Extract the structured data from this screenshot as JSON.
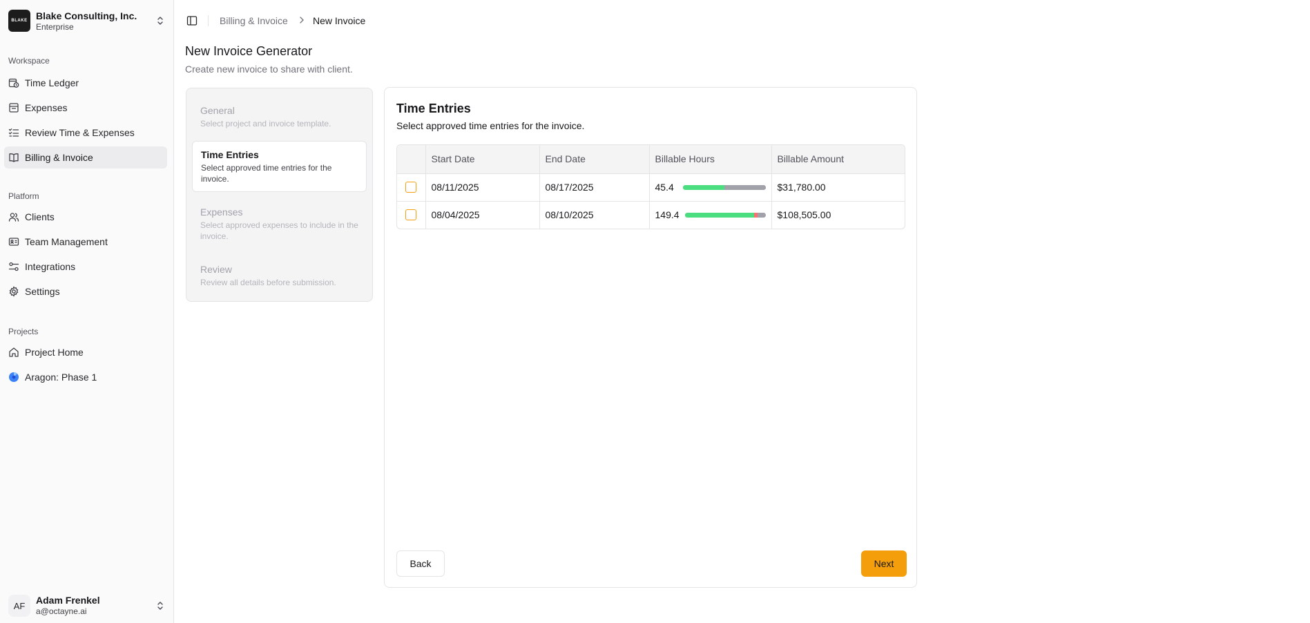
{
  "org": {
    "logo_text": "BLAKE",
    "name": "Blake Consulting, Inc.",
    "plan": "Enterprise"
  },
  "sidebar": {
    "workspace_label": "Workspace",
    "workspace_items": [
      {
        "label": "Time Ledger",
        "icon": "clock-calendar-icon"
      },
      {
        "label": "Expenses",
        "icon": "receipt-icon"
      },
      {
        "label": "Review Time & Expenses",
        "icon": "list-check-icon"
      },
      {
        "label": "Billing & Invoice",
        "icon": "book-icon",
        "active": true
      }
    ],
    "platform_label": "Platform",
    "platform_items": [
      {
        "label": "Clients",
        "icon": "users-icon"
      },
      {
        "label": "Team Management",
        "icon": "id-card-icon"
      },
      {
        "label": "Integrations",
        "icon": "sliders-icon"
      },
      {
        "label": "Settings",
        "icon": "gear-icon"
      }
    ],
    "projects_label": "Projects",
    "project_items": [
      {
        "label": "Project Home",
        "icon": "home-icon"
      },
      {
        "label": "Aragon: Phase 1",
        "icon": "pie-icon"
      }
    ]
  },
  "user": {
    "initials": "AF",
    "name": "Adam Frenkel",
    "email": "a@octayne.ai"
  },
  "breadcrumb": {
    "parent": "Billing & Invoice",
    "current": "New Invoice"
  },
  "page": {
    "title": "New Invoice Generator",
    "subtitle": "Create new invoice to share with client."
  },
  "steps": [
    {
      "title": "General",
      "desc": "Select project and invoice template."
    },
    {
      "title": "Time Entries",
      "desc": "Select approved time entries for the invoice.",
      "active": true
    },
    {
      "title": "Expenses",
      "desc": "Select approved expenses to include in the invoice."
    },
    {
      "title": "Review",
      "desc": "Review all details before submission."
    }
  ],
  "card": {
    "title": "Time Entries",
    "subtitle": "Select approved time entries for the invoice.",
    "columns": [
      "Start Date",
      "End Date",
      "Billable Hours",
      "Billable Amount"
    ],
    "rows": [
      {
        "start": "08/11/2025",
        "end": "08/17/2025",
        "hours": "45.4",
        "amount": "$31,780.00",
        "bar": [
          {
            "kind": "g",
            "frac": 0.5
          },
          {
            "kind": "gy",
            "frac": 0.5
          }
        ]
      },
      {
        "start": "08/04/2025",
        "end": "08/10/2025",
        "hours": "149.4",
        "amount": "$108,505.00",
        "bar": [
          {
            "kind": "g",
            "frac": 0.86
          },
          {
            "kind": "r",
            "frac": 0.04
          },
          {
            "kind": "gy",
            "frac": 0.1
          }
        ]
      }
    ],
    "back_label": "Back",
    "next_label": "Next"
  },
  "colors": {
    "accent": "#f59e0b",
    "billable_green": "#4ade80",
    "non_billable_red": "#f87171",
    "remaining_gray": "#a1a1aa"
  }
}
